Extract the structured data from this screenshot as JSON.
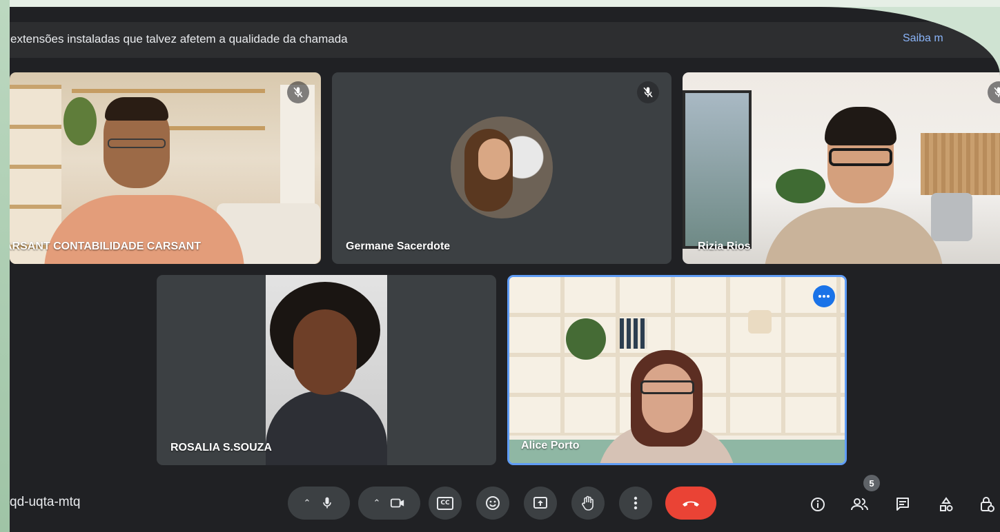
{
  "banner": {
    "text": "extensões instaladas que talvez afetem a qualidade da chamada",
    "link": "Saiba m"
  },
  "participants": [
    {
      "name": "ARSANT CONTABILIDADE CARSANT",
      "muted": true
    },
    {
      "name": "Germane Sacerdote",
      "muted": true
    },
    {
      "name": "Rizia Rios",
      "muted": true
    },
    {
      "name": "ROSALIA S.SOUZA",
      "muted": false
    },
    {
      "name": "Alice Porto",
      "muted": false,
      "active_speaker": true
    }
  ],
  "meeting": {
    "code": "qd-uqta-mtq"
  },
  "toolbar": {
    "mic": "mic-icon",
    "camera": "videocam-icon",
    "captions_label": "CC",
    "emoji": "emoji-icon",
    "present": "present-icon",
    "raise_hand": "hand-icon",
    "more": "more-vert-icon",
    "leave": "call-end-icon"
  },
  "people_count": "5",
  "colors": {
    "accent": "#8ab4f8",
    "leave": "#ea4335",
    "active_border": "#5f9cf5",
    "bar": "#3c4043"
  }
}
